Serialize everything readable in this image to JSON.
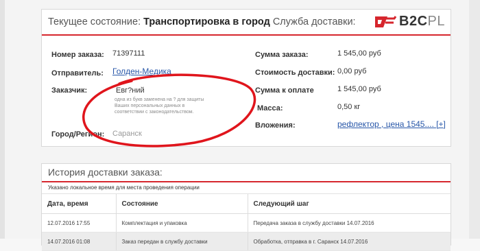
{
  "status": {
    "current_label": "Текущее состояние:",
    "current_value": "Транспортировка в город",
    "service_label": "Служба доставки:",
    "logo": {
      "b2c": "B2C",
      "pl": "PL",
      "brand_color": "#d6262d"
    }
  },
  "details_left": [
    {
      "label": "Номер заказа:",
      "value": "71397111"
    },
    {
      "label": "Отправитель:",
      "value": "Голден-Медика"
    },
    {
      "label": "Заказчик:",
      "value": "Евг?ний"
    },
    {
      "label": "Город/Регион:",
      "value": "Саранск"
    }
  ],
  "note": "одна из букв заменена на ? для защиты Ваших персональных данных в соответствии с законодательством.",
  "details_right": [
    {
      "label": "Сумма заказа:",
      "value": "1 545,00 руб"
    },
    {
      "label": "Стоимость доставки:",
      "value": "0,00 руб"
    },
    {
      "label": "Сумма к оплате",
      "value": "1 545,00 руб"
    },
    {
      "label": "Масса:",
      "value": "0,50 кг"
    },
    {
      "label": "Вложения:",
      "value": "рефлектор , цена 1545.... [+]"
    }
  ],
  "history": {
    "title": "История доставки заказа:",
    "subtitle": "Указано локальное время для места проведения операции",
    "columns": [
      "Дата, время",
      "Состояние",
      "Следующий шаг"
    ],
    "rows": [
      [
        "12.07.2016 17:55",
        "Комплектация и упаковка",
        "Передача заказа в службу доставки 14.07.2016"
      ],
      [
        "14.07.2016 01:08",
        "Заказ передан в службу доставки",
        "Обработка, отправка в г. Саранск 14.07.2016"
      ]
    ]
  }
}
